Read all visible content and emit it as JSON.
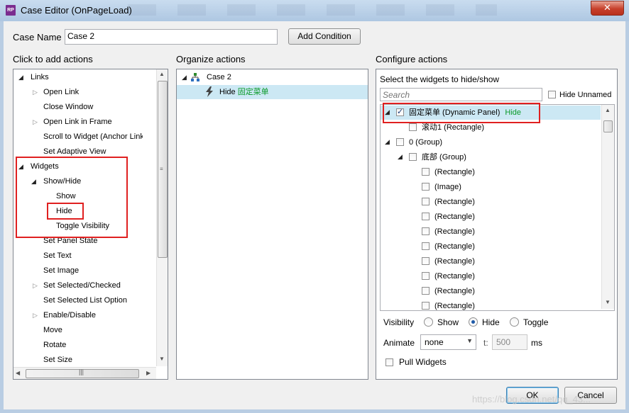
{
  "window": {
    "title": "Case Editor (OnPageLoad)",
    "app_icon_text": "RP",
    "close_symbol": "✕"
  },
  "header": {
    "case_name_label": "Case Name",
    "case_name_value": "Case 2",
    "add_condition_label": "Add Condition"
  },
  "left": {
    "title": "Click to add actions",
    "items": [
      "Links",
      "Open Link",
      "Close Window",
      "Open Link in Frame",
      "Scroll to Widget (Anchor Link)",
      "Set Adaptive View",
      "Widgets",
      "Show/Hide",
      "Show",
      "Hide",
      "Toggle Visibility",
      "Set Panel State",
      "Set Text",
      "Set Image",
      "Set Selected/Checked",
      "Set Selected List Option",
      "Enable/Disable",
      "Move",
      "Rotate",
      "Set Size"
    ]
  },
  "middle": {
    "title": "Organize actions",
    "case_label": "Case 2",
    "action_verb": "Hide",
    "action_target": "固定菜单"
  },
  "right": {
    "title": "Configure actions",
    "subtitle": "Select the widgets to hide/show",
    "search_placeholder": "Search",
    "hide_unnamed_label": "Hide Unnamed",
    "widgets": [
      {
        "label": "固定菜单 (Dynamic Panel)",
        "badge": "Hide",
        "checked": true
      },
      {
        "label": "滚动1 (Rectangle)",
        "checked": false
      },
      {
        "label": "0 (Group)",
        "checked": false
      },
      {
        "label": "底部 (Group)",
        "checked": false
      },
      {
        "label": "(Rectangle)",
        "checked": false
      },
      {
        "label": "(Image)",
        "checked": false
      },
      {
        "label": "(Rectangle)",
        "checked": false
      },
      {
        "label": "(Rectangle)",
        "checked": false
      },
      {
        "label": "(Rectangle)",
        "checked": false
      },
      {
        "label": "(Rectangle)",
        "checked": false
      },
      {
        "label": "(Rectangle)",
        "checked": false
      },
      {
        "label": "(Rectangle)",
        "checked": false
      },
      {
        "label": "(Rectangle)",
        "checked": false
      },
      {
        "label": "(Rectangle)",
        "checked": false
      }
    ],
    "visibility_label": "Visibility",
    "visibility_options": [
      "Show",
      "Hide",
      "Toggle"
    ],
    "visibility_selected": "Hide",
    "animate_label": "Animate",
    "animate_value": "none",
    "t_label": "t:",
    "t_value": "500",
    "ms_label": "ms",
    "pull_widgets_label": "Pull Widgets"
  },
  "footer": {
    "ok_label": "OK",
    "cancel_label": "Cancel"
  },
  "watermark": "https://blog.csdn.net/qq_43..."
}
